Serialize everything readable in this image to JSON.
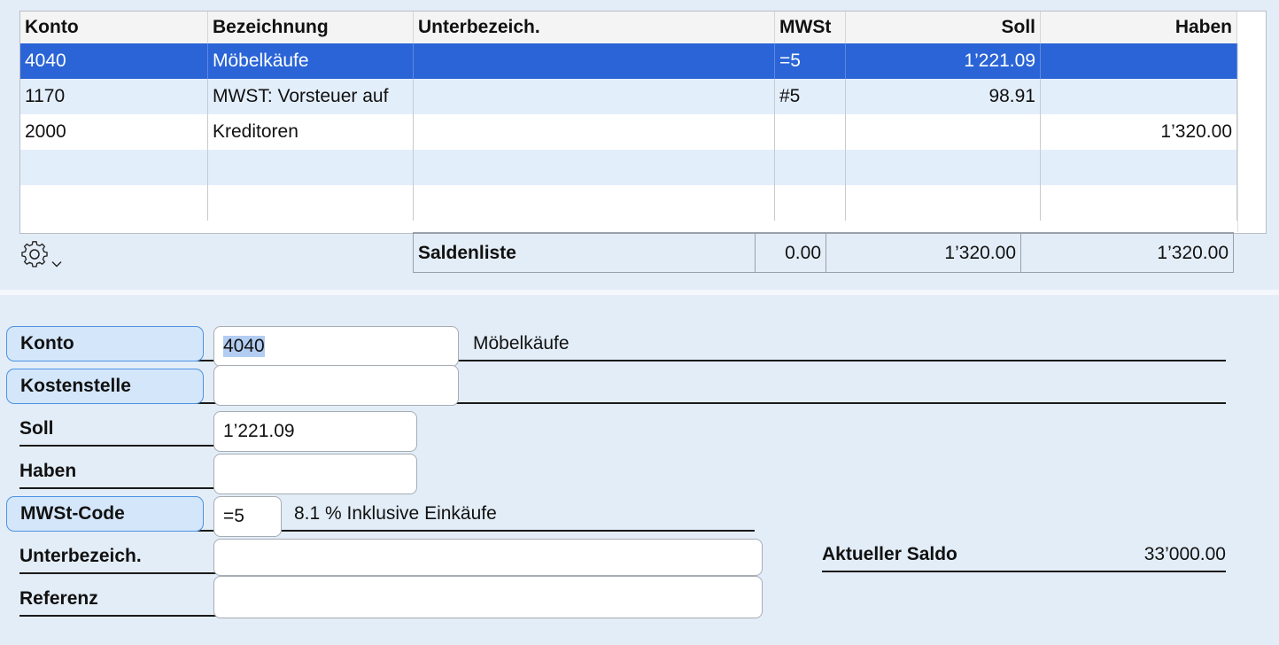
{
  "table": {
    "headers": {
      "konto": "Konto",
      "bezeichnung": "Bezeichnung",
      "unterbezeich": "Unterbezeich.",
      "mwst": "MWSt",
      "soll": "Soll",
      "haben": "Haben"
    },
    "rows": [
      {
        "konto": "4040",
        "bezeichnung": "Möbelkäufe",
        "unterbezeich": "",
        "mwst": "=5",
        "soll": "1’221.09",
        "haben": ""
      },
      {
        "konto": "1170",
        "bezeichnung": "MWST: Vorsteuer auf",
        "unterbezeich": "",
        "mwst": "#5",
        "soll": "98.91",
        "haben": ""
      },
      {
        "konto": "2000",
        "bezeichnung": "Kreditoren",
        "unterbezeich": "",
        "mwst": "",
        "soll": "",
        "haben": "1’320.00"
      },
      {
        "konto": "",
        "bezeichnung": "",
        "unterbezeich": "",
        "mwst": "",
        "soll": "",
        "haben": ""
      },
      {
        "konto": "",
        "bezeichnung": "",
        "unterbezeich": "",
        "mwst": "",
        "soll": "",
        "haben": ""
      }
    ],
    "selected_row": 0,
    "selection_color": "#2a64d6"
  },
  "saldenliste": {
    "label": "Saldenliste",
    "mwst": "0.00",
    "soll": "1’320.00",
    "haben": "1’320.00"
  },
  "toolbar": {
    "settings_icon": "gear-icon",
    "chevron_icon": "chevron-down-icon"
  },
  "form": {
    "konto": {
      "label": "Konto",
      "value": "4040",
      "description": "Möbelkäufe"
    },
    "kostenstelle": {
      "label": "Kostenstelle",
      "value": ""
    },
    "soll": {
      "label": "Soll",
      "value": "1’221.09"
    },
    "haben": {
      "label": "Haben",
      "value": ""
    },
    "mwst_code": {
      "label": "MWSt-Code",
      "value": "=5",
      "description": "8.1 % Inklusive Einkäufe"
    },
    "unterbezeich": {
      "label": "Unterbezeich.",
      "value": ""
    },
    "referenz": {
      "label": "Referenz",
      "value": ""
    },
    "aktueller_saldo": {
      "label": "Aktueller Saldo",
      "value": "33’000.00"
    }
  },
  "colors": {
    "background": "#e3edf7",
    "accent": "#4d93e3",
    "label_button_bg": "#d4e6fa"
  }
}
